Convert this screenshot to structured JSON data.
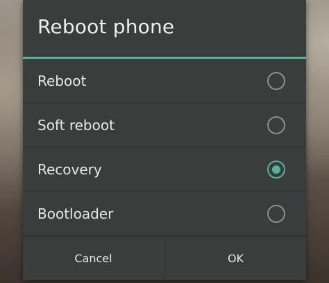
{
  "dialog": {
    "title": "Reboot phone",
    "accent_color": "#53b599",
    "options": [
      {
        "label": "Reboot",
        "selected": false
      },
      {
        "label": "Soft reboot",
        "selected": false
      },
      {
        "label": "Recovery",
        "selected": true
      },
      {
        "label": "Bootloader",
        "selected": false
      }
    ],
    "buttons": {
      "cancel_label": "Cancel",
      "ok_label": "OK"
    }
  }
}
